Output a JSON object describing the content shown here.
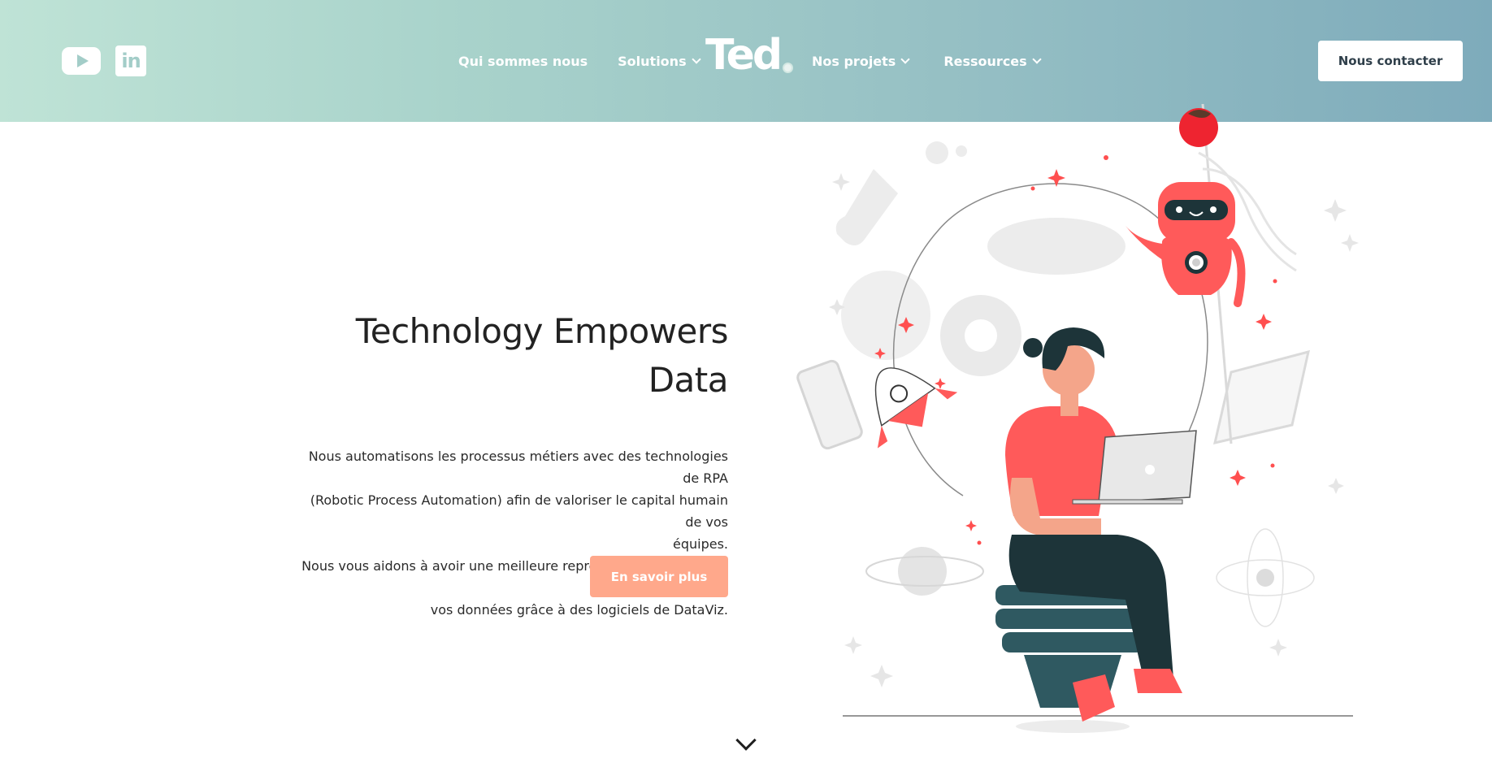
{
  "header": {
    "social": [
      {
        "name": "YouTube",
        "icon": "youtube-icon"
      },
      {
        "name": "LinkedIn",
        "icon": "linkedin-icon",
        "glyph": "in"
      }
    ],
    "nav_left": [
      {
        "label": "Qui sommes nous",
        "has_dropdown": false
      },
      {
        "label": "Solutions",
        "has_dropdown": true
      }
    ],
    "logo": {
      "text": "Ted"
    },
    "nav_right": [
      {
        "label": "Nos projets",
        "has_dropdown": true
      },
      {
        "label": "Ressources",
        "has_dropdown": true
      }
    ],
    "contact_label": "Nous contacter"
  },
  "hero": {
    "title_line1": "Technology Empowers",
    "title_line2": "Data",
    "desc_line1": "Nous automatisons les processus métiers avec des technologies de RPA",
    "desc_line2": "(Robotic Process Automation) afin de valoriser le capital humain de vos",
    "desc_line3": "équipes.",
    "desc_line4": "Nous vous aidons à avoir une meilleure représentation graphique de",
    "desc_line5": "vos données grâce à des logiciels de DataViz.",
    "cta_label": "En savoir plus"
  },
  "colors": {
    "header_gradient_start": "#bfe3d6",
    "header_gradient_end": "#7eabbb",
    "cta": "#ffa88b",
    "accent_red": "#ff5a5a",
    "dark_teal": "#1d3a3f"
  }
}
